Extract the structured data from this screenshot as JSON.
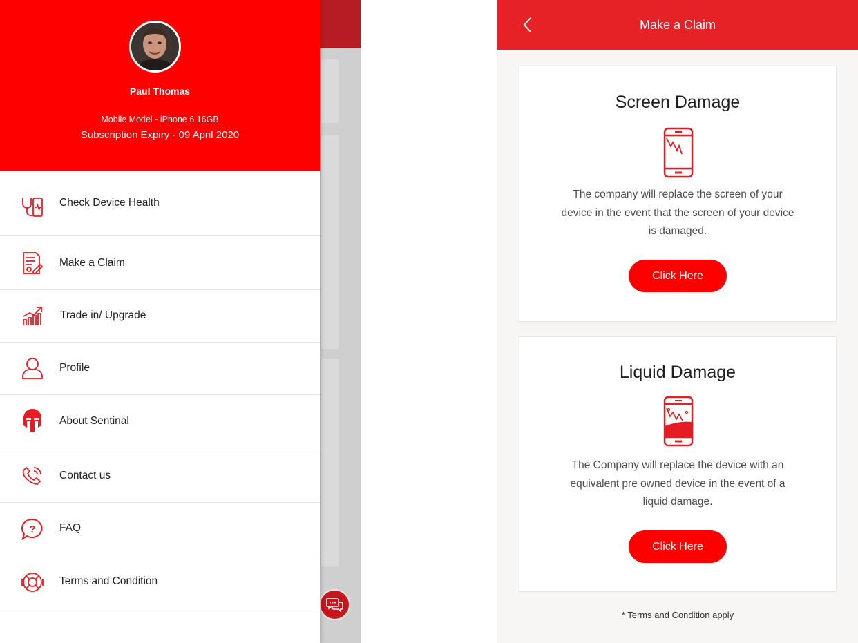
{
  "drawer": {
    "user_name": "Paul Thomas",
    "mobile_model": "Mobile Model - iPhone 6 16GB",
    "subscription_expiry": "Subscription Expiry - 09 April 2020",
    "items": [
      {
        "label": "Check Device Health",
        "icon": "stethoscope-phone-icon"
      },
      {
        "label": "Make a Claim",
        "icon": "claim-document-icon"
      },
      {
        "label": "Trade in/ Upgrade",
        "icon": "growth-chart-icon"
      },
      {
        "label": "Profile",
        "icon": "user-icon"
      },
      {
        "label": "About Sentinal",
        "icon": "spartan-helmet-icon"
      },
      {
        "label": "Contact us",
        "icon": "phone-icon"
      },
      {
        "label": "FAQ",
        "icon": "question-bubble-icon"
      },
      {
        "label": "Terms and Condition",
        "icon": "lifebuoy-icon"
      }
    ]
  },
  "claim_screen": {
    "title": "Make a Claim",
    "cards": [
      {
        "title": "Screen Damage",
        "description": "The company will replace the screen of your device in the event that the screen of your device is damaged.",
        "button_label": "Click Here",
        "icon": "cracked-phone-icon"
      },
      {
        "title": "Liquid Damage",
        "description": "The Company will replace the device with an equivalent pre owned device in the event of a liquid damage.",
        "button_label": "Click Here",
        "icon": "water-damaged-phone-icon"
      }
    ],
    "terms_note": "* Terms and Condition apply"
  },
  "colors": {
    "brand_red": "#fe0000",
    "appbar_red": "#e62226",
    "dark_red": "#b71c24"
  }
}
